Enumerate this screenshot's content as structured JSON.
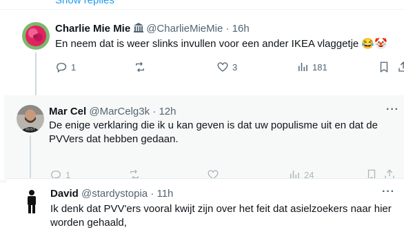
{
  "show_replies": "Show replies",
  "tweets": [
    {
      "display_name": "Charlie Mie Mie",
      "badge_icon": "bank-building-icon",
      "handle": "@CharlieMieMie",
      "separator": "·",
      "time": "16h",
      "text": "En neem dat is weer slinks invullen voor een ander IKEA vlaggetje 😂🤡",
      "stats": {
        "replies": "1",
        "reposts": "",
        "likes": "3",
        "views": "181"
      }
    },
    {
      "display_name": "Mar Cel",
      "handle": "@MarCelg3k",
      "separator": "·",
      "time": "12h",
      "more": "···",
      "text": "De enige verklaring die ik u kan geven is dat uw populisme uit en dat de PVVers dat hebben gedaan.",
      "stats": {
        "replies": "1",
        "reposts": "",
        "likes": "",
        "views": "24"
      }
    },
    {
      "display_name": "David",
      "handle": "@stardystopia",
      "separator": "·",
      "time": "11h",
      "more": "···",
      "text": "Ik denk dat PVV'ers vooral kwijt zijn over het feit dat asielzoekers naar hier worden gehaald,"
    }
  ],
  "colors": {
    "accent": "#1d9bf0",
    "muted": "#536471",
    "text": "#0f1419",
    "thread_line": "#cfd9de"
  }
}
